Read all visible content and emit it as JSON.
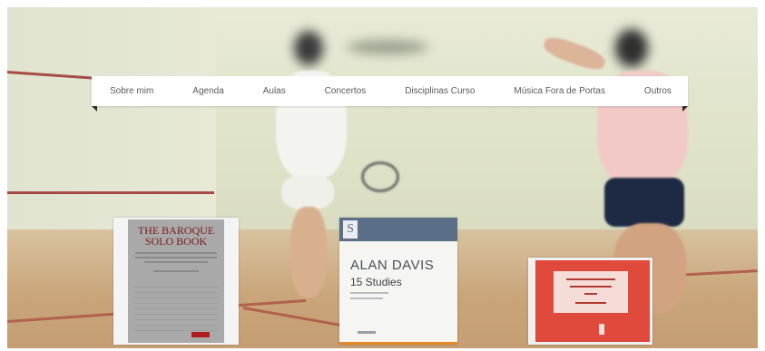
{
  "nav": {
    "items": [
      {
        "label": "Sobre mim"
      },
      {
        "label": "Agenda"
      },
      {
        "label": "Aulas"
      },
      {
        "label": "Concertos"
      },
      {
        "label": "Disciplinas Curso"
      },
      {
        "label": "Música Fora de Portas"
      },
      {
        "label": "Outros"
      }
    ]
  },
  "books": {
    "baroque": {
      "title_line1": "THE BAROQUE",
      "title_line2": "SOLO BOOK"
    },
    "davis": {
      "logo": "S",
      "author": "ALAN DAVIS",
      "title": "15 Studies"
    }
  },
  "colors": {
    "wall": "#e8ead7",
    "floor": "#caa57a",
    "court_line": "#a64b43",
    "nav_background": "#ffffff",
    "nav_text": "#5a5a5a"
  }
}
